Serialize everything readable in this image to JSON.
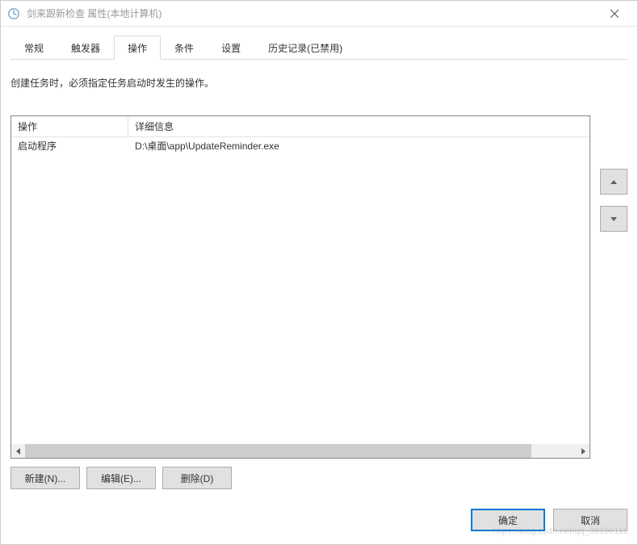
{
  "window": {
    "title": "剑来跟新检查 属性(本地计算机)"
  },
  "tabs": {
    "items": [
      {
        "label": "常规"
      },
      {
        "label": "触发器"
      },
      {
        "label": "操作"
      },
      {
        "label": "条件"
      },
      {
        "label": "设置"
      },
      {
        "label": "历史记录(已禁用)"
      }
    ],
    "active_index": 2
  },
  "panel": {
    "instructions": "创建任务时，必须指定任务启动时发生的操作。",
    "columns": {
      "action": "操作",
      "details": "详细信息"
    },
    "rows": [
      {
        "action": "启动程序",
        "details": "D:\\桌面\\app\\UpdateReminder.exe"
      }
    ],
    "buttons": {
      "new": "新建(N)...",
      "edit": "编辑(E)...",
      "delete": "删除(D)"
    }
  },
  "footer": {
    "ok": "确定",
    "cancel": "取消"
  },
  "watermark": "https://blog.csdn.net/qq_38190111"
}
